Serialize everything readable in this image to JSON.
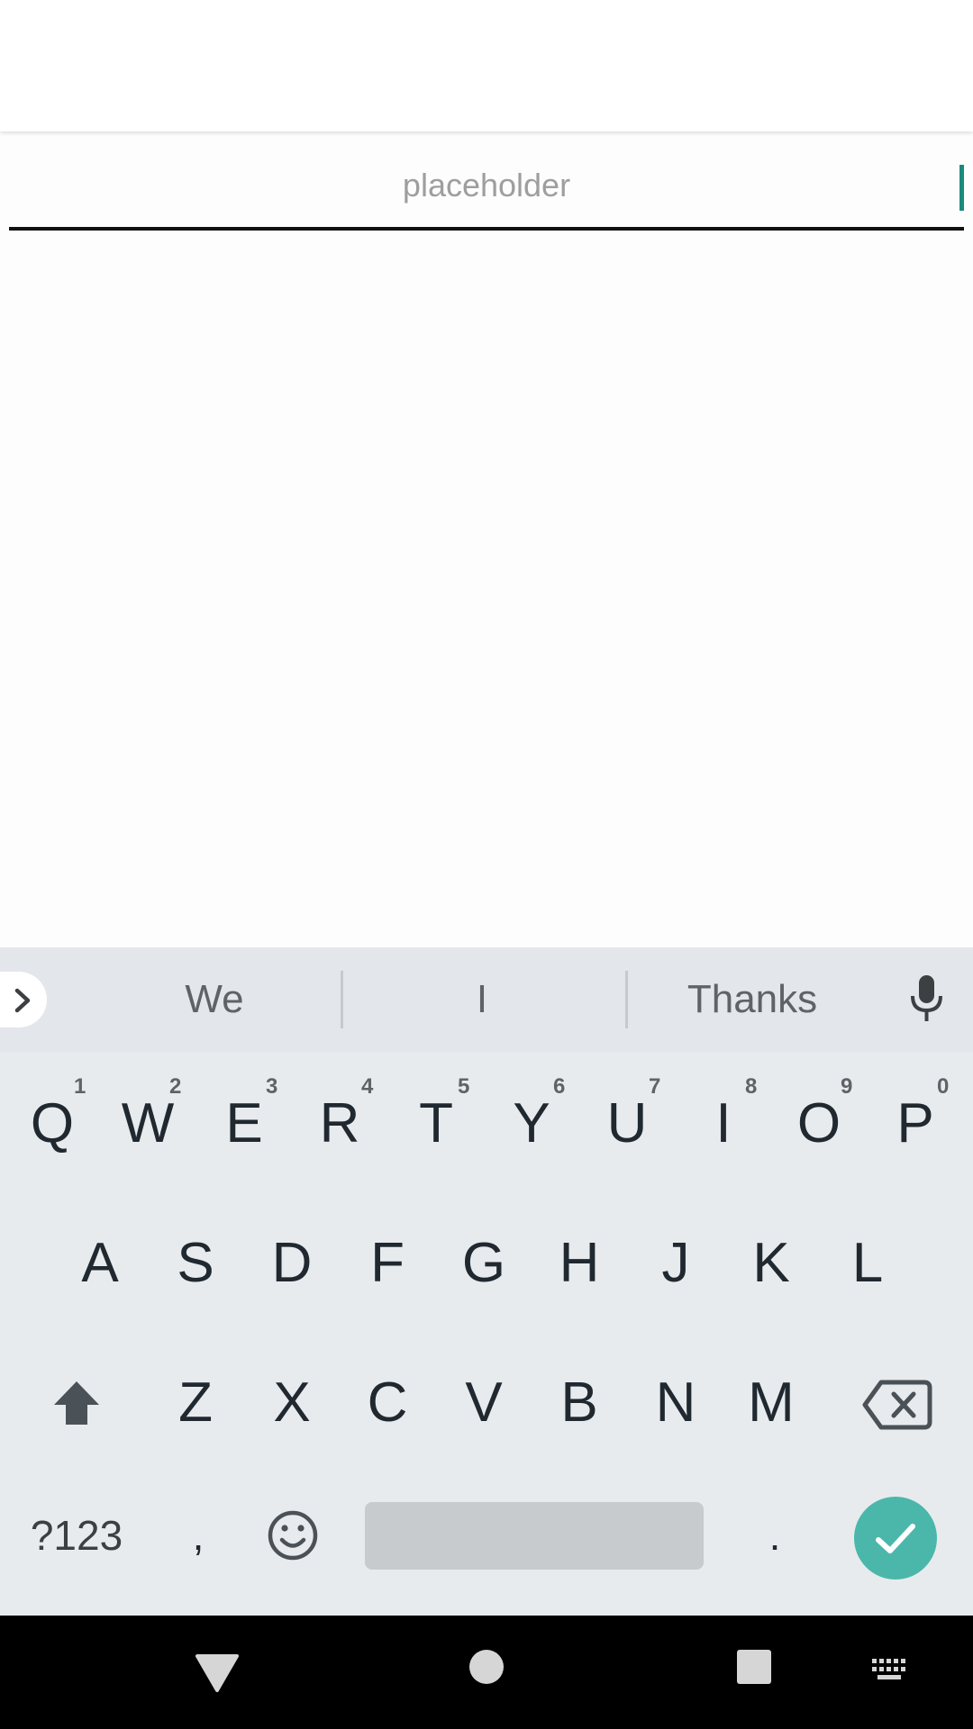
{
  "text_field": {
    "placeholder": "placeholder",
    "value": ""
  },
  "suggestions": [
    "We",
    "I",
    "Thanks"
  ],
  "keyboard": {
    "row1": [
      {
        "label": "Q",
        "hint": "1"
      },
      {
        "label": "W",
        "hint": "2"
      },
      {
        "label": "E",
        "hint": "3"
      },
      {
        "label": "R",
        "hint": "4"
      },
      {
        "label": "T",
        "hint": "5"
      },
      {
        "label": "Y",
        "hint": "6"
      },
      {
        "label": "U",
        "hint": "7"
      },
      {
        "label": "I",
        "hint": "8"
      },
      {
        "label": "O",
        "hint": "9"
      },
      {
        "label": "P",
        "hint": "0"
      }
    ],
    "row2": [
      "A",
      "S",
      "D",
      "F",
      "G",
      "H",
      "J",
      "K",
      "L"
    ],
    "row3": [
      "Z",
      "X",
      "C",
      "V",
      "B",
      "N",
      "M"
    ],
    "symbols_label": "?123",
    "comma_label": ",",
    "period_label": ".",
    "icons": {
      "expand": "chevron-right-icon",
      "mic": "microphone-icon",
      "shift": "shift-icon",
      "backspace": "backspace-icon",
      "emoji": "emoji-icon",
      "enter": "check-icon"
    }
  },
  "navigation": {
    "icons": [
      "back-icon",
      "home-icon",
      "recents-icon",
      "keyboard-switch-icon"
    ]
  },
  "colors": {
    "accent": "#4bb7aa",
    "cursor": "#1a8a7d",
    "keyboard_bg": "#e8ebee",
    "key_text": "#202830",
    "nav_bg": "#000000"
  }
}
